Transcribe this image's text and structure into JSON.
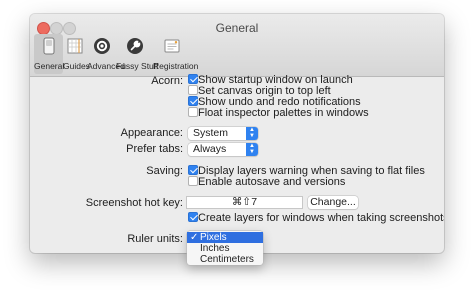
{
  "window": {
    "title": "General"
  },
  "tabs": [
    {
      "label": "General",
      "icon": "general-switch-icon",
      "active": true
    },
    {
      "label": "Guides",
      "icon": "guides-grid-icon",
      "active": false
    },
    {
      "label": "Advanced",
      "icon": "advanced-gear-icon",
      "active": false
    },
    {
      "label": "Fussy Stuff",
      "icon": "fussy-wrench-icon",
      "active": false
    },
    {
      "label": "Registration",
      "icon": "registration-card-icon",
      "active": false
    }
  ],
  "acorn": {
    "label": "Acorn:",
    "options": [
      {
        "label": "Show startup window on launch",
        "checked": true
      },
      {
        "label": "Set canvas origin to top left",
        "checked": false
      },
      {
        "label": "Show undo and redo notifications",
        "checked": true
      },
      {
        "label": "Float inspector palettes in windows",
        "checked": false
      }
    ]
  },
  "appearance": {
    "label": "Appearance:",
    "value": "System"
  },
  "prefer_tabs": {
    "label": "Prefer tabs:",
    "value": "Always"
  },
  "saving": {
    "label": "Saving:",
    "options": [
      {
        "label": "Display layers warning when saving to flat files",
        "checked": true
      },
      {
        "label": "Enable autosave and versions",
        "checked": false
      }
    ]
  },
  "screenshot": {
    "label": "Screenshot hot key:",
    "hotkey": "⌘⇧7",
    "change_button": "Change...",
    "option": {
      "label": "Create layers for windows when taking screenshots",
      "checked": true
    }
  },
  "ruler": {
    "label": "Ruler units:",
    "check_mark": "✓",
    "options": [
      "Pixels",
      "Inches",
      "Centimeters"
    ],
    "selected": "Pixels"
  },
  "colors": {
    "accent": "#2f82f0",
    "close": "#ed6b5f",
    "menu_highlight": "#2f6fe0"
  }
}
